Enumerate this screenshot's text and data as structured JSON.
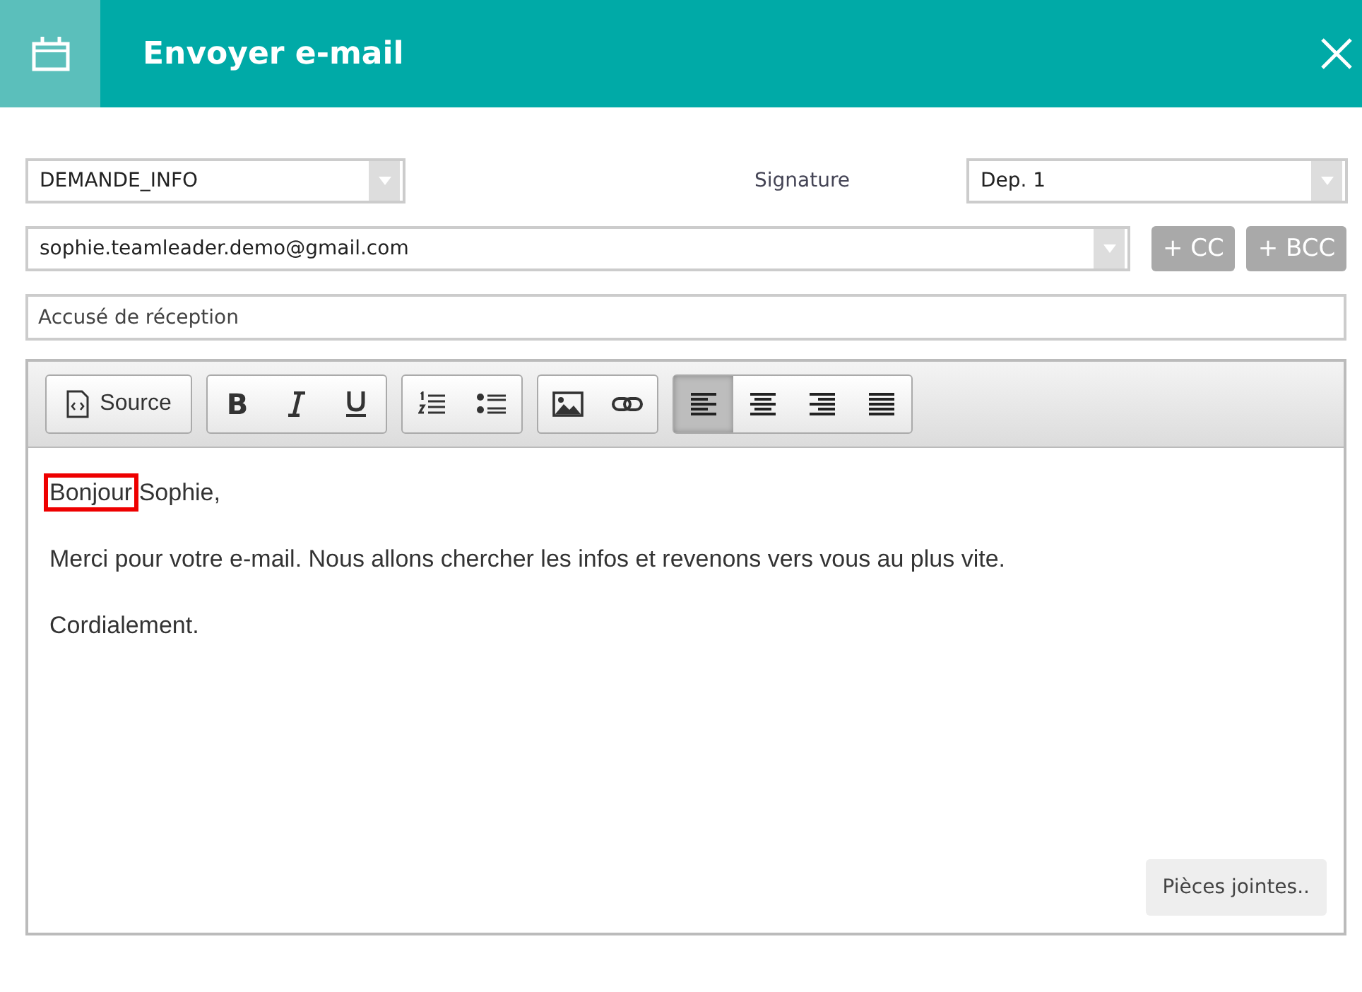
{
  "header": {
    "title": "Envoyer e-mail"
  },
  "template_select": {
    "value": "DEMANDE_INFO"
  },
  "signature": {
    "label": "Signature",
    "value": "Dep. 1"
  },
  "recipient": {
    "value": "sophie.teamleader.demo@gmail.com"
  },
  "cc_buttons": [
    "+ CC",
    "+ BCC"
  ],
  "subject": {
    "value": "Accusé de réception"
  },
  "toolbar": [
    {
      "items": [
        {
          "kind": "source",
          "label": "Source",
          "selected": false
        }
      ]
    },
    {
      "items": [
        {
          "kind": "bold",
          "glyph": "B",
          "selected": false
        },
        {
          "kind": "italic",
          "selected": false
        },
        {
          "kind": "underline",
          "selected": false
        }
      ]
    },
    {
      "items": [
        {
          "kind": "numbered-list",
          "selected": false
        },
        {
          "kind": "bullet-list",
          "selected": false
        }
      ]
    },
    {
      "items": [
        {
          "kind": "image",
          "selected": false
        },
        {
          "kind": "link",
          "selected": false
        }
      ]
    },
    {
      "items": [
        {
          "kind": "align-left",
          "selected": true
        },
        {
          "kind": "align-center",
          "selected": false
        },
        {
          "kind": "align-right",
          "selected": false
        },
        {
          "kind": "align-justify",
          "selected": false
        }
      ]
    }
  ],
  "body": [
    {
      "highlight": "Bonjour",
      "text": " Sophie,"
    },
    {
      "text": "Merci pour votre e-mail. Nous allons chercher les infos et revenons vers vous au plus vite."
    },
    {
      "text": "Cordialement."
    }
  ],
  "attachments_button": "Pièces jointes.."
}
